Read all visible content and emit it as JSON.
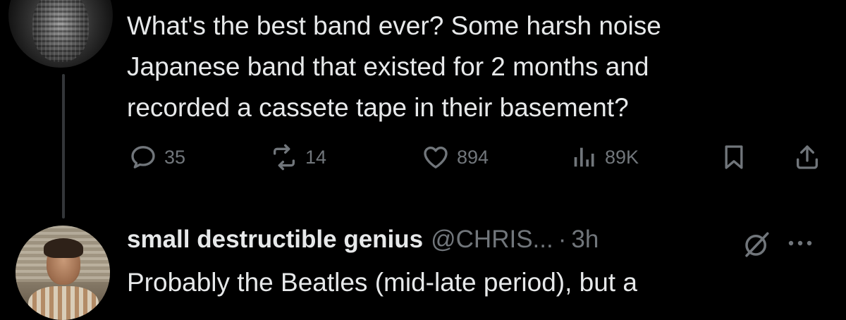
{
  "tweet": {
    "text": "What's the best band ever? Some harsh noise\nJapanese band that existed for 2 months and\nrecorded a cassete tape in their basement?",
    "actions": {
      "replies": "35",
      "reposts": "14",
      "likes": "894",
      "views": "89K"
    }
  },
  "reply": {
    "display_name": "small destructible genius",
    "handle": "@CHRIS...",
    "separator": "·",
    "time": "3h",
    "text": "Probably the Beatles (mid-late period), but a"
  },
  "colors": {
    "background": "#000000",
    "text": "#e7e9ea",
    "muted": "#71767b",
    "thread_line": "#333639"
  },
  "icons": [
    "reply-icon",
    "repost-icon",
    "like-icon",
    "views-icon",
    "bookmark-icon",
    "share-icon",
    "grok-icon",
    "more-icon"
  ]
}
